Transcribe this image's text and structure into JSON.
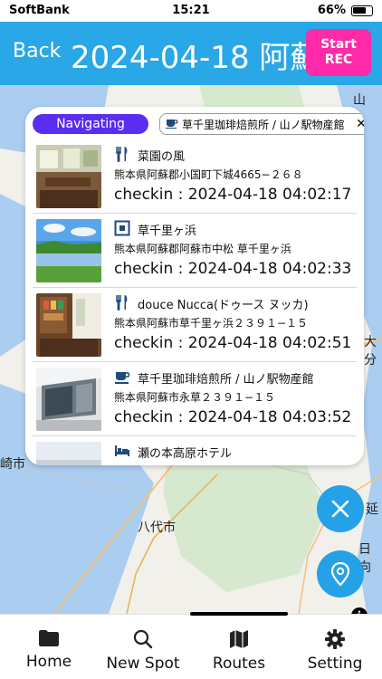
{
  "status_bar": {
    "carrier": "SoftBank",
    "time": "15:21",
    "battery": "66%"
  },
  "header": {
    "back_label": "Back",
    "title": "2024-04-18 阿蘇",
    "rec_label_line1": "Start",
    "rec_label_line2": "REC"
  },
  "panel": {
    "badge": "Navigating",
    "route_chip": "草千里珈琲焙煎所 / 山ノ駅物産館",
    "spots": [
      {
        "icon": "restaurant-icon",
        "name": "菜園の風",
        "address": "熊本県阿蘇郡小国町下城4665−２６８",
        "checkin": "checkin : 2024-04-18 04:02:17"
      },
      {
        "icon": "landmark-icon",
        "name": "草千里ヶ浜",
        "address": "熊本県阿蘇郡阿蘇市中松 草千里ヶ浜",
        "checkin": "checkin : 2024-04-18 04:02:33"
      },
      {
        "icon": "restaurant-icon",
        "name": "douce Nucca(ドゥース ヌッカ)",
        "address": "熊本県阿蘇市草千里ヶ浜２３９１−１５",
        "checkin": "checkin : 2024-04-18 04:02:51"
      },
      {
        "icon": "cafe-icon",
        "name": "草千里珈琲焙煎所 / 山ノ駅物産館",
        "address": "熊本県阿蘇市永草２３９１−１５",
        "checkin": "checkin : 2024-04-18 04:03:52"
      },
      {
        "icon": "hotel-icon",
        "name": "瀬の本高原ホテル",
        "address": "",
        "checkin": ""
      }
    ]
  },
  "map": {
    "labels": [
      "八代市",
      "崎市",
      "延",
      "日向",
      "大分",
      "山"
    ]
  },
  "tabs": [
    {
      "icon": "folder-icon",
      "label": "Home"
    },
    {
      "icon": "search-icon",
      "label": "New Spot"
    },
    {
      "icon": "map-icon",
      "label": "Routes"
    },
    {
      "icon": "gear-icon",
      "label": "Setting"
    }
  ],
  "colors": {
    "header": "#29a7e7",
    "rec_button": "#ff2aa8",
    "badge": "#5b2cf2",
    "fab": "#24a1e7"
  }
}
